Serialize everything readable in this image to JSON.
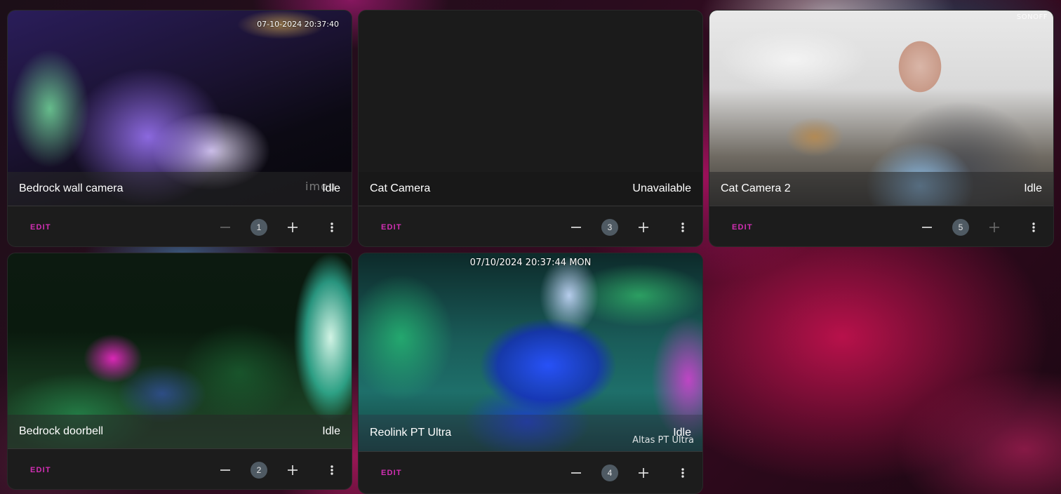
{
  "cards": [
    {
      "name": "Bedrock wall camera",
      "state": "Idle",
      "timestamp": "07-10-2024 20:37:40",
      "brand": "imou",
      "edit_label": "EDIT",
      "order": "1",
      "minus_icon": "minus-icon",
      "plus_icon": "plus-icon",
      "menu_icon": "more-vertical-icon"
    },
    {
      "name": "Cat Camera",
      "state": "Unavailable",
      "edit_label": "EDIT",
      "order": "3",
      "minus_icon": "minus-icon",
      "plus_icon": "plus-icon",
      "menu_icon": "more-vertical-icon"
    },
    {
      "name": "Cat Camera 2",
      "state": "Idle",
      "brand": "SONOFF",
      "edit_label": "EDIT",
      "order": "5",
      "minus_icon": "minus-icon",
      "plus_icon": "plus-icon",
      "menu_icon": "more-vertical-icon"
    },
    {
      "name": "Bedrock doorbell",
      "state": "Idle",
      "edit_label": "EDIT",
      "order": "2",
      "minus_icon": "minus-icon",
      "plus_icon": "plus-icon",
      "menu_icon": "more-vertical-icon"
    },
    {
      "name": "Reolink PT Ultra",
      "state": "Idle",
      "timestamp": "07/10/2024 20:37:44 MON",
      "watermark": "Altas PT Ultra",
      "edit_label": "EDIT",
      "order": "4",
      "minus_icon": "minus-icon",
      "plus_icon": "plus-icon",
      "menu_icon": "more-vertical-icon"
    }
  ],
  "colors": {
    "accent": "#d22fb4",
    "card_bg": "#1c1c1c",
    "badge_bg": "#4f5a63"
  }
}
